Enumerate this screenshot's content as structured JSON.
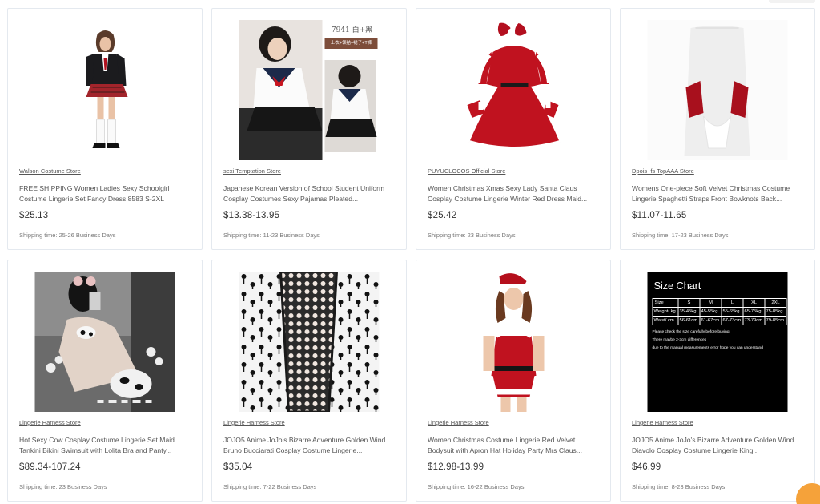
{
  "products": [
    {
      "store": "Walson Costume Store",
      "title": "FREE SHIPPING Women Ladies Sexy Schoolgirl Costume Lingerie Set Fancy Dress 8583 S-2XL",
      "price": "$25.13",
      "shipping": "Shipping time: 25-26 Business Days",
      "image": "schoolgirl-costume-photo"
    },
    {
      "store": "sexi Temptation Store",
      "title": "Japanese Korean Version of School Student Uniform Cosplay Costumes Sexy Pajamas Pleated...",
      "price": "$13.38-13.95",
      "shipping": "Shipping time: 11-23 Business Days",
      "image": "sailor-uniform-photo",
      "image_label_1": "7941 白+黑",
      "image_label_2": "上衣+领结+裙子+T裤"
    },
    {
      "store": "PUYUCLOCOS Official Store",
      "title": "Women Christmas Xmas Sexy Lady Santa Claus Cosplay Costume Lingerie Winter Red Dress Maid...",
      "price": "$25.42",
      "shipping": "Shipping time: 23 Business Days",
      "image": "santa-dress-photo"
    },
    {
      "store": "Dpois_fs TopAAA Store",
      "title": "Womens One-piece Soft Velvet Christmas Costume Lingerie Spaghetti Straps Front Bowknots Back...",
      "price": "$11.07-11.65",
      "shipping": "Shipping time: 17-23 Business Days",
      "image": "velvet-costume-photo"
    },
    {
      "store": "Lingerie Harness Store",
      "title": "Hot Sexy Cow Cosplay Costume Lingerie Set Maid Tankini Bikini Swimsuit with Lolita Bra and Panty...",
      "price": "$89.34-107.24",
      "shipping": "Shipping time: 23 Business Days",
      "image": "cow-cosplay-photo"
    },
    {
      "store": "Lingerie Harness Store",
      "title": "JOJO5 Anime JoJo's Bizarre Adventure Golden Wind Bruno Bucciarati Cosplay Costume Lingerie...",
      "price": "$35.04",
      "shipping": "Shipping time: 7-22 Business Days",
      "image": "zipper-pattern-lace-photo"
    },
    {
      "store": "Lingerie Harness Store",
      "title": "Women Christmas Costume Lingerie Red Velvet Bodysuit with Apron Hat Holiday Party Mrs Claus...",
      "price": "$12.98-13.99",
      "shipping": "Shipping time: 16-22 Business Days",
      "image": "red-velvet-bodysuit-photo"
    },
    {
      "store": "Lingerie Harness Store",
      "title": "JOJO5 Anime JoJo's Bizarre Adventure Golden Wind Diavolo Cosplay Costume Lingerie King...",
      "price": "$46.99",
      "shipping": "Shipping time: 8-23 Business Days",
      "image": "size-chart-image",
      "size_chart": {
        "title": "Size Chart",
        "headers": [
          "Size",
          "S",
          "M",
          "L",
          "XL",
          "2XL"
        ],
        "rows": [
          [
            "Weight/ kg",
            "35-45kg",
            "45-55kg",
            "55-65kg",
            "65-75kg",
            "75-85kg"
          ],
          [
            "Waist/ cm",
            "56-61cm",
            "61-67cm",
            "67-73cm",
            "73-79cm",
            "79-85cm"
          ]
        ],
        "notes": [
          "Please check the size carefully before buying.",
          "There maybe 2-3cm differences",
          "due to the manual measurements error hope you can understand"
        ]
      }
    }
  ],
  "colors": {
    "border": "#e4e9ef",
    "price": "#333333",
    "chat_accent": "#f5a23a"
  }
}
